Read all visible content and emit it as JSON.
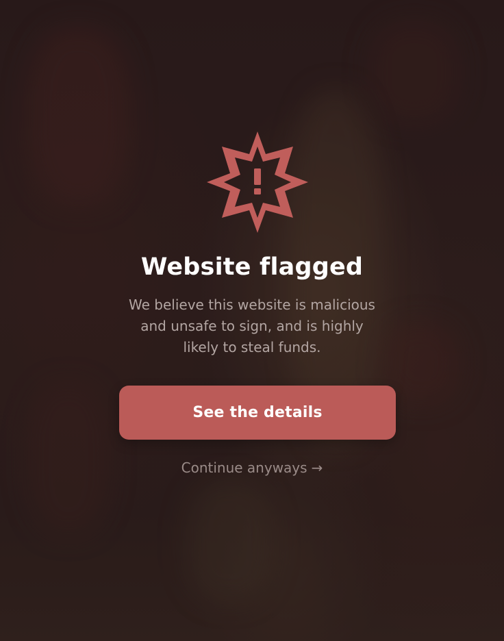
{
  "dialog": {
    "icon": "warning-star-icon",
    "exclamation": "!",
    "title": "Website flagged",
    "description": "We believe this website is malicious and unsafe to sign, and is highly likely to steal funds.",
    "primary_button_label": "See the details",
    "secondary_link_label": "Continue anyways",
    "secondary_link_arrow": "→"
  },
  "colors": {
    "accent": "#bb5b58",
    "background": "#2a1c1b",
    "title": "#ffffff",
    "description": "#b3a6a3",
    "link": "#9a8b88"
  }
}
